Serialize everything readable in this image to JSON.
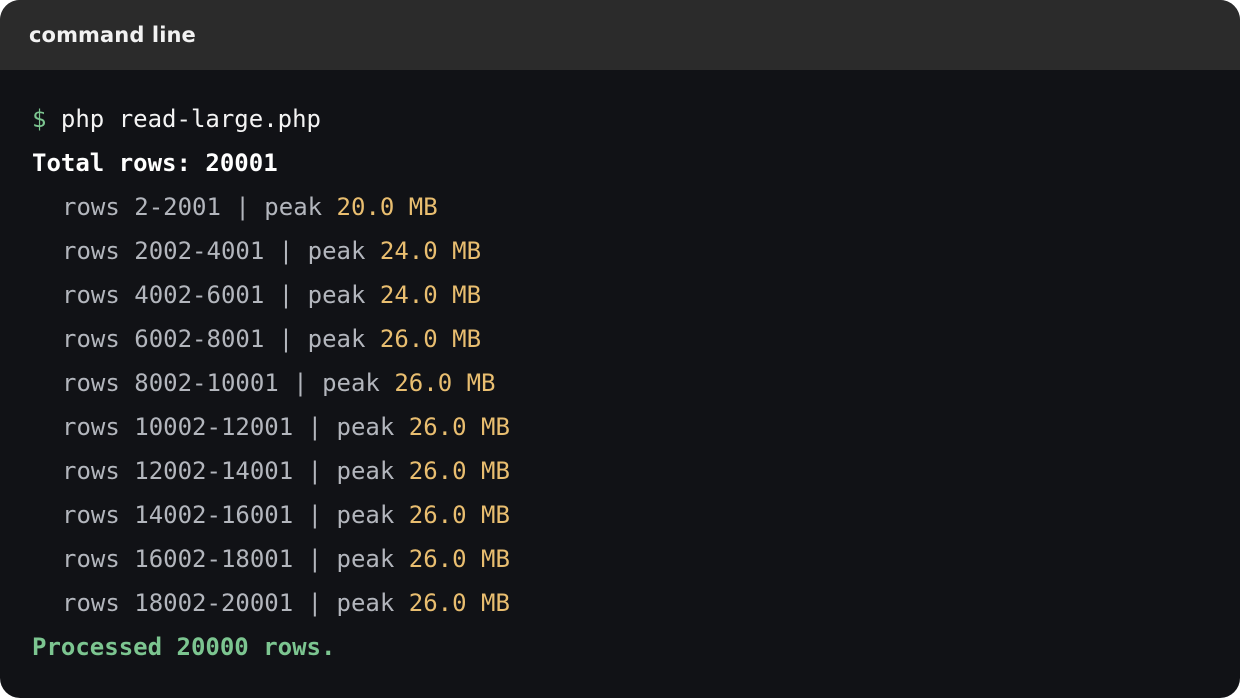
{
  "window": {
    "title": "command line"
  },
  "terminal": {
    "prompt_symbol": "$",
    "command": "php read-large.php",
    "total_line": "Total rows: 20001",
    "rows": [
      {
        "prefix": "rows 2-2001 | peak ",
        "peak": "20.0 MB"
      },
      {
        "prefix": "rows 2002-4001 | peak ",
        "peak": "24.0 MB"
      },
      {
        "prefix": "rows 4002-6001 | peak ",
        "peak": "24.0 MB"
      },
      {
        "prefix": "rows 6002-8001 | peak ",
        "peak": "26.0 MB"
      },
      {
        "prefix": "rows 8002-10001 | peak ",
        "peak": "26.0 MB"
      },
      {
        "prefix": "rows 10002-12001 | peak ",
        "peak": "26.0 MB"
      },
      {
        "prefix": "rows 12002-14001 | peak ",
        "peak": "26.0 MB"
      },
      {
        "prefix": "rows 14002-16001 | peak ",
        "peak": "26.0 MB"
      },
      {
        "prefix": "rows 16002-18001 | peak ",
        "peak": "26.0 MB"
      },
      {
        "prefix": "rows 18002-20001 | peak ",
        "peak": "26.0 MB"
      }
    ],
    "summary": "Processed 20000 rows."
  },
  "colors": {
    "window_bg": "#111216",
    "titlebar_bg": "#2b2b2b",
    "prompt": "#7cc590",
    "peak_value": "#e9be70",
    "row_text": "#b3b6bd",
    "summary": "#7cc590"
  }
}
